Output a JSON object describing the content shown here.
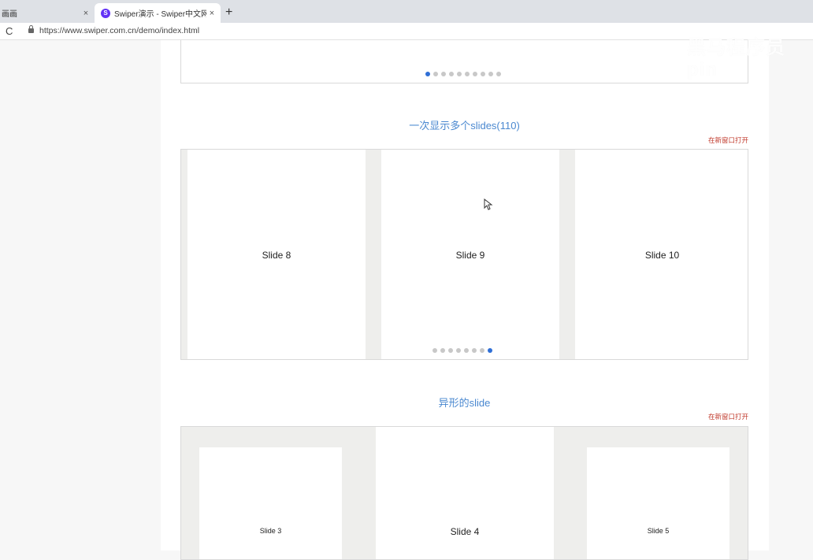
{
  "browser": {
    "tabs": [
      {
        "title": "画画",
        "close": "×"
      },
      {
        "title": "Swiper演示 - Swiper中文网",
        "close": "×",
        "favicon": "S"
      }
    ],
    "new_tab": "+",
    "reload_icon": "C",
    "url": "https://www.swiper.com.cn/demo/index.html"
  },
  "watermark": "黑马程序员pin",
  "sections": [
    {
      "pagination_total": 10,
      "pagination_active": 0
    },
    {
      "title": "一次显示多个slides(110)",
      "open_link": "在新窗口打开",
      "slides": [
        "Slide 8",
        "Slide 9",
        "Slide 10"
      ],
      "pagination_total": 8,
      "pagination_active": 7
    },
    {
      "title": "异形的slide",
      "open_link": "在新窗口打开",
      "slides": [
        "Slide 3",
        "Slide 4",
        "Slide 5"
      ]
    }
  ],
  "colors": {
    "accent": "#4a88d0",
    "active_dot": "#2f6fd6",
    "link": "#c0392b"
  }
}
